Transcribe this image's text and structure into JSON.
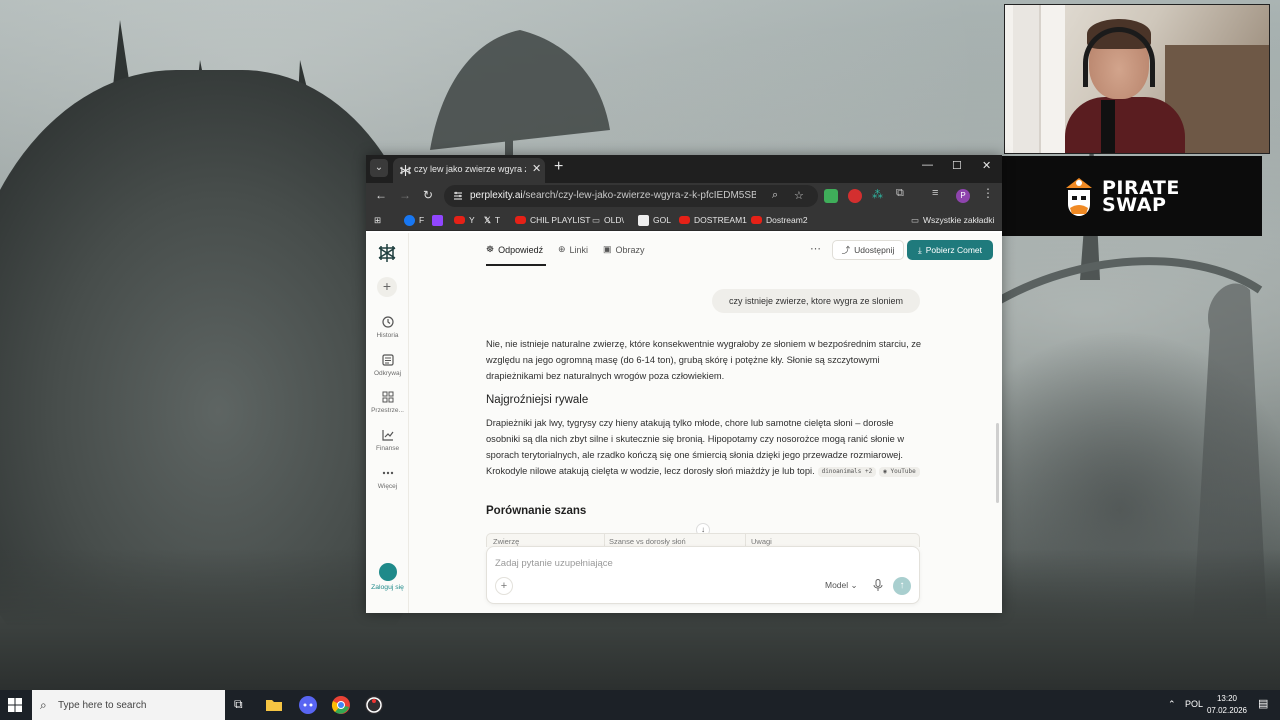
{
  "sponsor": {
    "brand_line1": "PIRATE",
    "brand_line2": "SWAP"
  },
  "browser": {
    "tab_title": "czy lew jako zwierze wgyra z k...",
    "url_host": "perplexity.ai",
    "url_path": "/search/czy-lew-jako-zwierze-wgyra-z-k-pfcIEDM5SB.Ct...",
    "bookmarks": [
      "F",
      "",
      "Y",
      "T",
      "CHIL PLAYLIST",
      "OLD\\",
      "GOL",
      "DOSTREAM1",
      "Dostream2"
    ],
    "bookmarks_all": "Wszystkie zakładki"
  },
  "sidebar": {
    "items": [
      {
        "label": "Historia",
        "icon": "history-icon"
      },
      {
        "label": "Odkrywaj",
        "icon": "discover-icon"
      },
      {
        "label": "Przestrze...",
        "icon": "spaces-icon"
      },
      {
        "label": "Finanse",
        "icon": "finance-icon"
      },
      {
        "label": "Więcej",
        "icon": "more-icon"
      }
    ],
    "login": "Zaloguj się"
  },
  "topnav": {
    "answer": "Odpowiedź",
    "links": "Linki",
    "images": "Obrazy",
    "share": "Udostępnij",
    "download": "Pobierz Comet"
  },
  "thread": {
    "question": "czy istnieje zwierze, ktore wygra ze sloniem",
    "paragraph1": "Nie, nie istnieje naturalne zwierzę, które konsekwentnie wygrałoby ze słoniem w bezpośrednim starciu, ze względu na jego ogromną masę (do 6-14 ton), grubą skórę i potężne kły. Słonie są szczytowymi drapieżnikami bez naturalnych wrogów poza człowiekiem.",
    "heading1": "Najgroźniejsi rywale",
    "paragraph2": "Drapieżniki jak lwy, tygrysy czy hieny atakują tylko młode, chore lub samotne cielęta słoni – dorosłe osobniki są dla nich zbyt silne i skutecznie się bronią. Hipopotamy czy nosorożce mogą ranić słonie w sporach terytorialnych, ale rzadko kończą się one śmiercią słonia dzięki jego przewadze rozmiarowej. Krokodyle nilowe atakują cielęta w wodzie, lecz dorosły słoń miażdży je lub topi.",
    "citation1": "dinoanimals +2",
    "citation2": "YouTube",
    "heading2": "Porównanie szans",
    "table_headers": [
      "Zwierzę",
      "Szanse vs dorosły słoń",
      "Uwagi"
    ]
  },
  "composer": {
    "placeholder": "Zadaj pytanie uzupełniające",
    "model": "Model"
  },
  "taskbar": {
    "search_placeholder": "Type here to search",
    "language": "POL",
    "time": "13:20",
    "date": "07.02.2026"
  }
}
